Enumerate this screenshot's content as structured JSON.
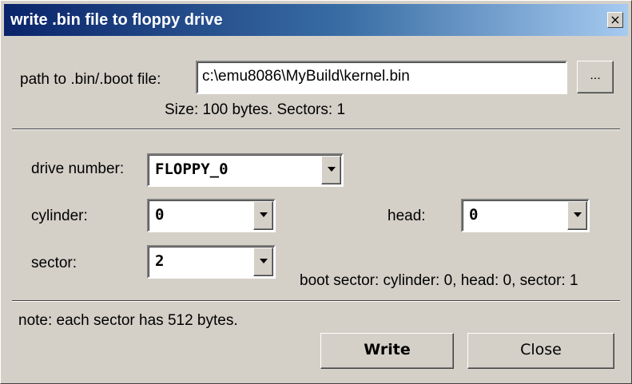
{
  "window": {
    "title": "write .bin file to floppy drive",
    "close_glyph": "×"
  },
  "file": {
    "path_label": "path to .bin/.boot file:",
    "path_value": "c:\\emu8086\\MyBuild\\kernel.bin",
    "browse_label": "...",
    "size_info": "Size: 100 bytes. Sectors: 1"
  },
  "params": {
    "drive_label": "drive number:",
    "drive_value": "FLOPPY_0",
    "cylinder_label": "cylinder:",
    "cylinder_value": "0",
    "head_label": "head:",
    "head_value": "0",
    "sector_label": "sector:",
    "sector_value": "2",
    "boot_sector_info": "boot sector: cylinder: 0, head: 0, sector: 1"
  },
  "footer": {
    "note": "note: each sector has 512 bytes.",
    "write_label": "Write",
    "close_label": "Close"
  },
  "colors": {
    "face": "#d4d0c8",
    "title_start": "#0a246a",
    "title_end": "#a6caf0"
  }
}
